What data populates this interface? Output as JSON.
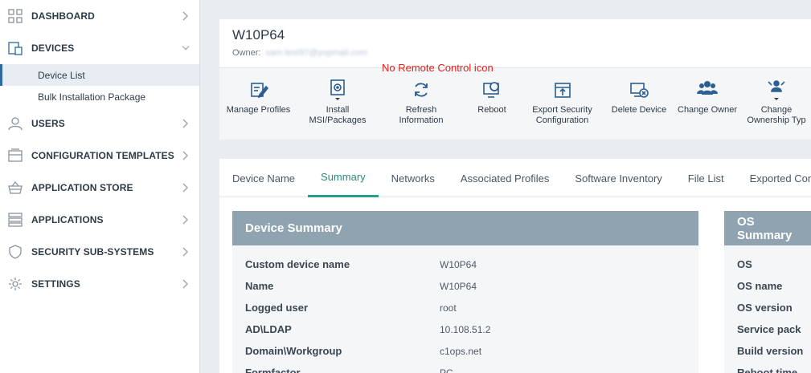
{
  "sidebar": {
    "items": [
      {
        "label": "DASHBOARD",
        "icon": "dashboard-icon",
        "expanded": false
      },
      {
        "label": "DEVICES",
        "icon": "devices-icon",
        "expanded": true,
        "children": [
          {
            "label": "Device List",
            "active": true
          },
          {
            "label": "Bulk Installation Package",
            "active": false
          }
        ]
      },
      {
        "label": "USERS",
        "icon": "user-icon",
        "expanded": false
      },
      {
        "label": "CONFIGURATION TEMPLATES",
        "icon": "templates-icon",
        "expanded": false
      },
      {
        "label": "APPLICATION STORE",
        "icon": "basket-icon",
        "expanded": false
      },
      {
        "label": "APPLICATIONS",
        "icon": "applications-icon",
        "expanded": false
      },
      {
        "label": "SECURITY SUB-SYSTEMS",
        "icon": "shield-icon",
        "expanded": false
      },
      {
        "label": "SETTINGS",
        "icon": "gear-icon",
        "expanded": false
      }
    ]
  },
  "device": {
    "title": "W10P64",
    "owner_label": "Owner:",
    "owner_value": "sam.test97@yopmail.com"
  },
  "toolbar": {
    "note": "No Remote Control icon",
    "actions": [
      {
        "label": "Manage Profiles",
        "icon": "manage-profiles-icon"
      },
      {
        "label": "Install\nMSI/Packages",
        "icon": "install-package-icon"
      },
      {
        "label": "Refresh\nInformation",
        "icon": "refresh-icon"
      },
      {
        "label": "Reboot",
        "icon": "reboot-icon"
      },
      {
        "label": "Export Security\nConfiguration",
        "icon": "export-icon"
      },
      {
        "label": "Delete Device",
        "icon": "delete-device-icon"
      },
      {
        "label": "Change Owner",
        "icon": "change-owner-icon"
      },
      {
        "label": "Change\nOwnership Typ",
        "icon": "ownership-type-icon"
      }
    ]
  },
  "tabs": [
    {
      "label": "Device Name",
      "active": false
    },
    {
      "label": "Summary",
      "active": true
    },
    {
      "label": "Networks",
      "active": false
    },
    {
      "label": "Associated Profiles",
      "active": false
    },
    {
      "label": "Software Inventory",
      "active": false
    },
    {
      "label": "File List",
      "active": false
    },
    {
      "label": "Exported Con",
      "active": false
    }
  ],
  "device_summary": {
    "title": "Device Summary",
    "rows": [
      {
        "key": "Custom device name",
        "value": "W10P64"
      },
      {
        "key": "Name",
        "value": "W10P64"
      },
      {
        "key": "Logged user",
        "value": "root"
      },
      {
        "key": "AD\\LDAP",
        "value": "10.108.51.2"
      },
      {
        "key": "Domain\\Workgroup",
        "value": "c1ops.net"
      },
      {
        "key": "Formfactor",
        "value": "PC"
      }
    ]
  },
  "os_summary": {
    "title": "OS Summary",
    "rows": [
      {
        "key": "OS"
      },
      {
        "key": "OS name"
      },
      {
        "key": "OS version"
      },
      {
        "key": "Service pack"
      },
      {
        "key": "Build version"
      },
      {
        "key": "Reboot time"
      }
    ]
  },
  "colors": {
    "accent": "#2a9d8f",
    "panel_header": "#8fa3b1",
    "note": "#e0201c",
    "toolbar_icon": "#2c5f92"
  }
}
